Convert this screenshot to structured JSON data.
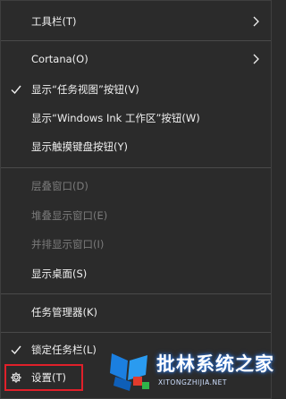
{
  "menu": {
    "items": [
      {
        "label": "工具栏(T)",
        "submenu": true,
        "checked": false,
        "disabled": false
      },
      {
        "label": "Cortana(O)",
        "submenu": true,
        "checked": false,
        "disabled": false
      },
      {
        "label": "显示“任务视图”按钮(V)",
        "submenu": false,
        "checked": true,
        "disabled": false
      },
      {
        "label": "显示“Windows Ink 工作区”按钮(W)",
        "submenu": false,
        "checked": false,
        "disabled": false
      },
      {
        "label": "显示触摸键盘按钮(Y)",
        "submenu": false,
        "checked": false,
        "disabled": false
      },
      {
        "label": "层叠窗口(D)",
        "submenu": false,
        "checked": false,
        "disabled": true
      },
      {
        "label": "堆叠显示窗口(E)",
        "submenu": false,
        "checked": false,
        "disabled": true
      },
      {
        "label": "并排显示窗口(I)",
        "submenu": false,
        "checked": false,
        "disabled": true
      },
      {
        "label": "显示桌面(S)",
        "submenu": false,
        "checked": false,
        "disabled": false
      },
      {
        "label": "任务管理器(K)",
        "submenu": false,
        "checked": false,
        "disabled": false
      },
      {
        "label": "锁定任务栏(L)",
        "submenu": false,
        "checked": true,
        "disabled": false
      },
      {
        "label": "设置(T)",
        "submenu": false,
        "checked": false,
        "disabled": false,
        "icon": "gear-icon"
      }
    ]
  },
  "watermark": {
    "title": "批林系统之家",
    "subtitle": "XITONGZHIJIA.NET"
  },
  "colors": {
    "background": "#2b2b2b",
    "text": "#f0f0f0",
    "disabled_text": "#7b7b7b",
    "separator": "#4a4a4a",
    "highlight_border": "#e0202a"
  }
}
